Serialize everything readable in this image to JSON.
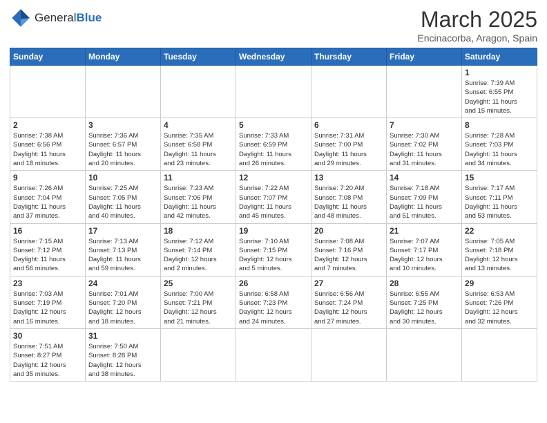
{
  "header": {
    "logo_general": "General",
    "logo_blue": "Blue",
    "month": "March 2025",
    "location": "Encinacorba, Aragon, Spain"
  },
  "weekdays": [
    "Sunday",
    "Monday",
    "Tuesday",
    "Wednesday",
    "Thursday",
    "Friday",
    "Saturday"
  ],
  "weeks": [
    [
      {
        "day": "",
        "info": ""
      },
      {
        "day": "",
        "info": ""
      },
      {
        "day": "",
        "info": ""
      },
      {
        "day": "",
        "info": ""
      },
      {
        "day": "",
        "info": ""
      },
      {
        "day": "",
        "info": ""
      },
      {
        "day": "1",
        "info": "Sunrise: 7:39 AM\nSunset: 6:55 PM\nDaylight: 11 hours\nand 15 minutes."
      }
    ],
    [
      {
        "day": "2",
        "info": "Sunrise: 7:38 AM\nSunset: 6:56 PM\nDaylight: 11 hours\nand 18 minutes."
      },
      {
        "day": "3",
        "info": "Sunrise: 7:36 AM\nSunset: 6:57 PM\nDaylight: 11 hours\nand 20 minutes."
      },
      {
        "day": "4",
        "info": "Sunrise: 7:35 AM\nSunset: 6:58 PM\nDaylight: 11 hours\nand 23 minutes."
      },
      {
        "day": "5",
        "info": "Sunrise: 7:33 AM\nSunset: 6:59 PM\nDaylight: 11 hours\nand 26 minutes."
      },
      {
        "day": "6",
        "info": "Sunrise: 7:31 AM\nSunset: 7:00 PM\nDaylight: 11 hours\nand 29 minutes."
      },
      {
        "day": "7",
        "info": "Sunrise: 7:30 AM\nSunset: 7:02 PM\nDaylight: 11 hours\nand 31 minutes."
      },
      {
        "day": "8",
        "info": "Sunrise: 7:28 AM\nSunset: 7:03 PM\nDaylight: 11 hours\nand 34 minutes."
      }
    ],
    [
      {
        "day": "9",
        "info": "Sunrise: 7:26 AM\nSunset: 7:04 PM\nDaylight: 11 hours\nand 37 minutes."
      },
      {
        "day": "10",
        "info": "Sunrise: 7:25 AM\nSunset: 7:05 PM\nDaylight: 11 hours\nand 40 minutes."
      },
      {
        "day": "11",
        "info": "Sunrise: 7:23 AM\nSunset: 7:06 PM\nDaylight: 11 hours\nand 42 minutes."
      },
      {
        "day": "12",
        "info": "Sunrise: 7:22 AM\nSunset: 7:07 PM\nDaylight: 11 hours\nand 45 minutes."
      },
      {
        "day": "13",
        "info": "Sunrise: 7:20 AM\nSunset: 7:08 PM\nDaylight: 11 hours\nand 48 minutes."
      },
      {
        "day": "14",
        "info": "Sunrise: 7:18 AM\nSunset: 7:09 PM\nDaylight: 11 hours\nand 51 minutes."
      },
      {
        "day": "15",
        "info": "Sunrise: 7:17 AM\nSunset: 7:11 PM\nDaylight: 11 hours\nand 53 minutes."
      }
    ],
    [
      {
        "day": "16",
        "info": "Sunrise: 7:15 AM\nSunset: 7:12 PM\nDaylight: 11 hours\nand 56 minutes."
      },
      {
        "day": "17",
        "info": "Sunrise: 7:13 AM\nSunset: 7:13 PM\nDaylight: 11 hours\nand 59 minutes."
      },
      {
        "day": "18",
        "info": "Sunrise: 7:12 AM\nSunset: 7:14 PM\nDaylight: 12 hours\nand 2 minutes."
      },
      {
        "day": "19",
        "info": "Sunrise: 7:10 AM\nSunset: 7:15 PM\nDaylight: 12 hours\nand 5 minutes."
      },
      {
        "day": "20",
        "info": "Sunrise: 7:08 AM\nSunset: 7:16 PM\nDaylight: 12 hours\nand 7 minutes."
      },
      {
        "day": "21",
        "info": "Sunrise: 7:07 AM\nSunset: 7:17 PM\nDaylight: 12 hours\nand 10 minutes."
      },
      {
        "day": "22",
        "info": "Sunrise: 7:05 AM\nSunset: 7:18 PM\nDaylight: 12 hours\nand 13 minutes."
      }
    ],
    [
      {
        "day": "23",
        "info": "Sunrise: 7:03 AM\nSunset: 7:19 PM\nDaylight: 12 hours\nand 16 minutes."
      },
      {
        "day": "24",
        "info": "Sunrise: 7:01 AM\nSunset: 7:20 PM\nDaylight: 12 hours\nand 18 minutes."
      },
      {
        "day": "25",
        "info": "Sunrise: 7:00 AM\nSunset: 7:21 PM\nDaylight: 12 hours\nand 21 minutes."
      },
      {
        "day": "26",
        "info": "Sunrise: 6:58 AM\nSunset: 7:23 PM\nDaylight: 12 hours\nand 24 minutes."
      },
      {
        "day": "27",
        "info": "Sunrise: 6:56 AM\nSunset: 7:24 PM\nDaylight: 12 hours\nand 27 minutes."
      },
      {
        "day": "28",
        "info": "Sunrise: 6:55 AM\nSunset: 7:25 PM\nDaylight: 12 hours\nand 30 minutes."
      },
      {
        "day": "29",
        "info": "Sunrise: 6:53 AM\nSunset: 7:26 PM\nDaylight: 12 hours\nand 32 minutes."
      }
    ],
    [
      {
        "day": "30",
        "info": "Sunrise: 7:51 AM\nSunset: 8:27 PM\nDaylight: 12 hours\nand 35 minutes."
      },
      {
        "day": "31",
        "info": "Sunrise: 7:50 AM\nSunset: 8:28 PM\nDaylight: 12 hours\nand 38 minutes."
      },
      {
        "day": "",
        "info": ""
      },
      {
        "day": "",
        "info": ""
      },
      {
        "day": "",
        "info": ""
      },
      {
        "day": "",
        "info": ""
      },
      {
        "day": "",
        "info": ""
      }
    ]
  ]
}
